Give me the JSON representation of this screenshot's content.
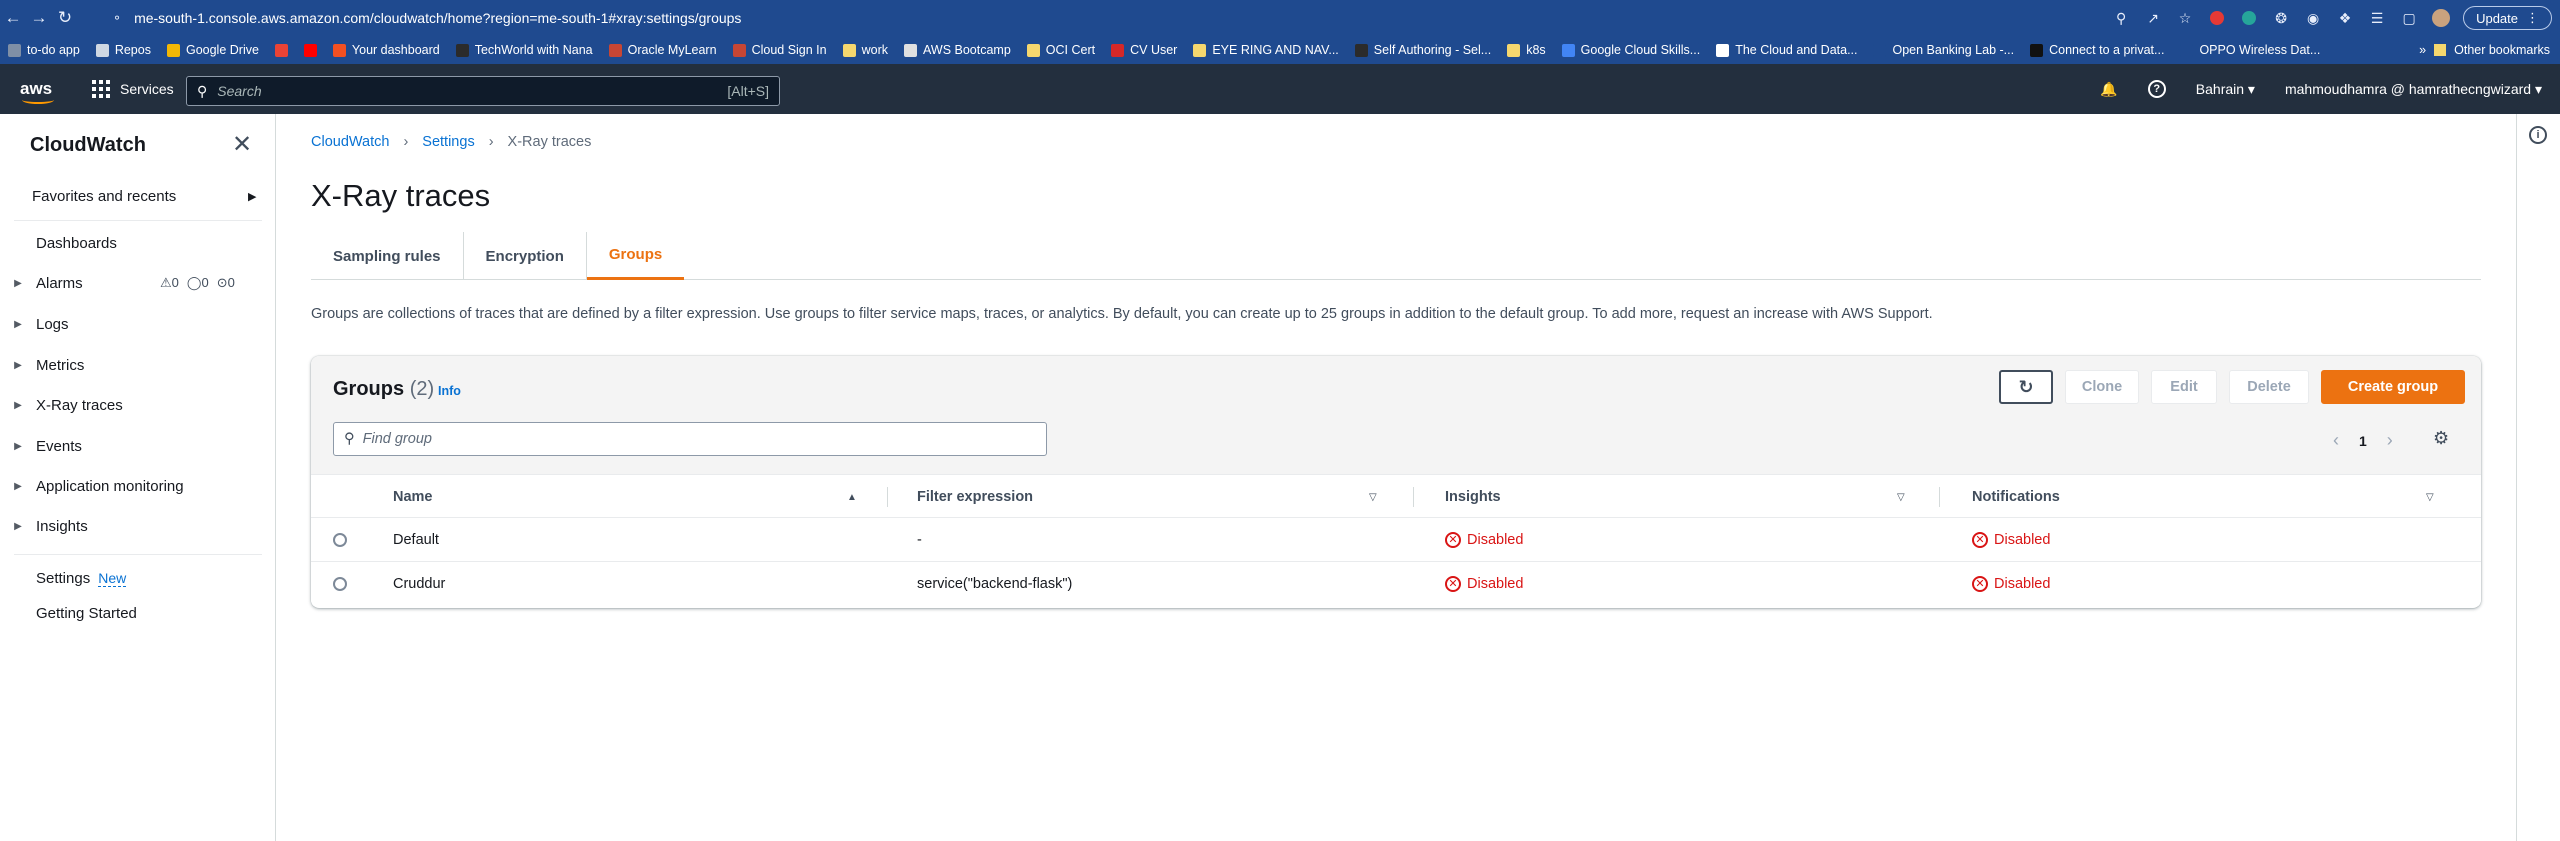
{
  "browser": {
    "url": "me-south-1.console.aws.amazon.com/cloudwatch/home?region=me-south-1#xray:settings/groups",
    "update_label": "Update",
    "bookmarks": [
      {
        "label": "to-do app",
        "color": "#7f8fa6"
      },
      {
        "label": "Repos",
        "color": "#cfd8e3"
      },
      {
        "label": "Google Drive",
        "color": "#f2b705"
      },
      {
        "label": "",
        "color": "#ea4335"
      },
      {
        "label": "",
        "color": "#ff0000"
      },
      {
        "label": "Your dashboard",
        "color": "#f25022"
      },
      {
        "label": "TechWorld with Nana",
        "color": "#2b2b2b"
      },
      {
        "label": "Oracle MyLearn",
        "color": "#c74634"
      },
      {
        "label": "Cloud Sign In",
        "color": "#c74634"
      },
      {
        "label": "work",
        "color": "#f5d76e"
      },
      {
        "label": "AWS Bootcamp",
        "color": "#e0e0e0"
      },
      {
        "label": "OCI Cert",
        "color": "#f5d76e"
      },
      {
        "label": "CV User",
        "color": "#d62828"
      },
      {
        "label": "EYE RING AND NAV...",
        "color": "#f5d76e"
      },
      {
        "label": "Self Authoring - Sel...",
        "color": "#2b2b2b"
      },
      {
        "label": "k8s",
        "color": "#f5d76e"
      },
      {
        "label": "Google Cloud Skills...",
        "color": "#4285f4"
      },
      {
        "label": "The Cloud and Data...",
        "color": "#ffffff"
      },
      {
        "label": "Open Banking Lab -...",
        "color": "#1f4a8f"
      },
      {
        "label": "Connect to a privat...",
        "color": "#111111"
      },
      {
        "label": "OPPO Wireless Dat...",
        "color": "#1f4a8f"
      }
    ],
    "other_bookmarks": "Other bookmarks"
  },
  "aws_nav": {
    "services_label": "Services",
    "search_placeholder": "Search",
    "search_hint": "[Alt+S]",
    "region": "Bahrain",
    "account": "mahmoudhamra @ hamrathecngwizard"
  },
  "sidebar": {
    "title": "CloudWatch",
    "favorites": "Favorites and recents",
    "dashboards": "Dashboards",
    "alarms": "Alarms",
    "alarm_counts": [
      "0",
      "0",
      "0"
    ],
    "logs": "Logs",
    "metrics": "Metrics",
    "xray": "X-Ray traces",
    "events": "Events",
    "app_monitoring": "Application monitoring",
    "insights": "Insights",
    "settings": "Settings",
    "settings_badge": "New",
    "getting_started": "Getting Started"
  },
  "breadcrumb": [
    "CloudWatch",
    "Settings",
    "X-Ray traces"
  ],
  "page_title": "X-Ray traces",
  "tabs": [
    "Sampling rules",
    "Encryption",
    "Groups"
  ],
  "description": "Groups are collections of traces that are defined by a filter expression. Use groups to filter service maps, traces, or analytics. By default, you can create up to 25 groups in addition to the default group. To add more, request an increase with AWS Support.",
  "groups_panel": {
    "title": "Groups",
    "count": "(2)",
    "info": "Info",
    "buttons": {
      "clone": "Clone",
      "edit": "Edit",
      "delete": "Delete",
      "create": "Create group"
    },
    "find_placeholder": "Find group",
    "page": "1",
    "columns": [
      "Name",
      "Filter expression",
      "Insights",
      "Notifications"
    ],
    "rows": [
      {
        "name": "Default",
        "filter": "-",
        "insights": "Disabled",
        "notifications": "Disabled"
      },
      {
        "name": "Cruddur",
        "filter": "service(\"backend-flask\")",
        "insights": "Disabled",
        "notifications": "Disabled"
      }
    ]
  }
}
